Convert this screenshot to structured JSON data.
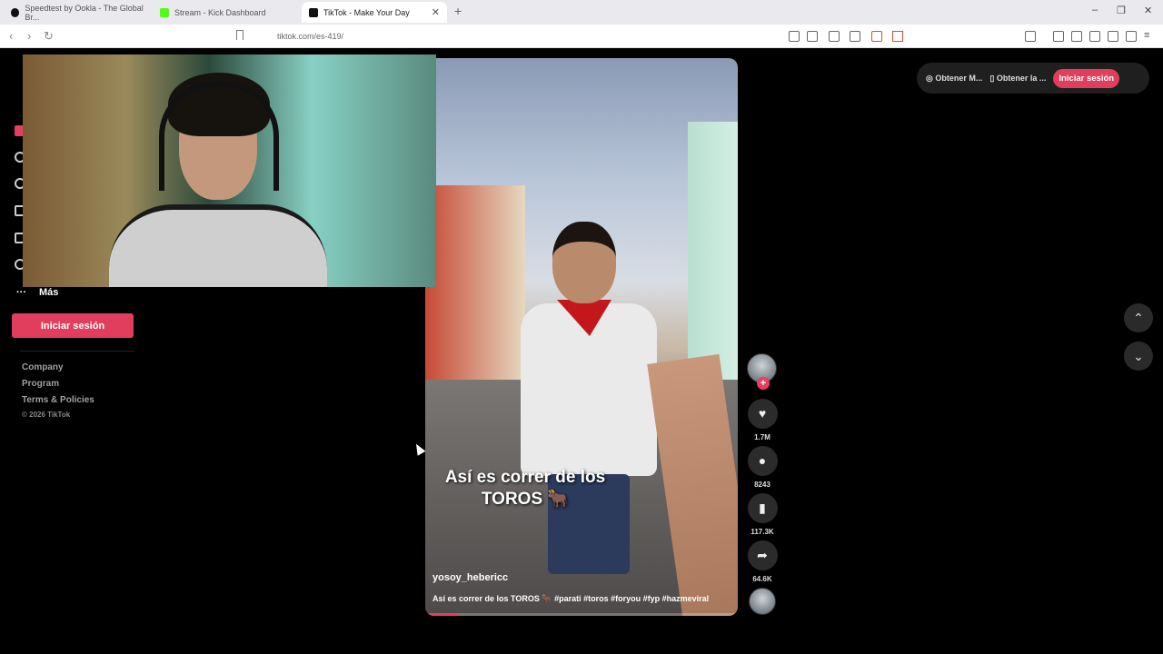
{
  "browser": {
    "tabs": [
      {
        "title": "Speedtest by Ookla - The Global Br...",
        "active": false,
        "favicon_color": "#111111"
      },
      {
        "title": "Stream - Kick Dashboard",
        "active": false,
        "favicon_color": "#53fc18"
      },
      {
        "title": "TikTok - Make Your Day",
        "active": true,
        "favicon_color": "#111111"
      }
    ],
    "new_tab_label": "+",
    "url": "tiktok.com/es-419/",
    "window_controls": [
      "–",
      "❐",
      "✕"
    ]
  },
  "sidebar": {
    "more_label": "Más",
    "more_icon": "···",
    "login_label": "Iniciar sesión",
    "footer_links": [
      "Company",
      "Program",
      "Terms & Policies"
    ],
    "copyright": "© 2026 TikTok"
  },
  "topbar": {
    "coins_label": "Obtener M...",
    "app_label": "Obtener la ...",
    "login_label": "Iniciar sesión"
  },
  "video": {
    "caption": "Así es correr de los TOROS 🐂",
    "username": "yosoy_hebericc",
    "description": "Así es correr de los TOROS 🐂 #parati #toros #foryou #fyp #hazmeviral",
    "progress": 0.11
  },
  "actions": {
    "likes": "1.7M",
    "comments": "8243",
    "saves": "117.3K",
    "shares": "64.6K",
    "follow_symbol": "+"
  },
  "nav": {
    "up_icon": "⌃",
    "down_icon": "⌄"
  }
}
